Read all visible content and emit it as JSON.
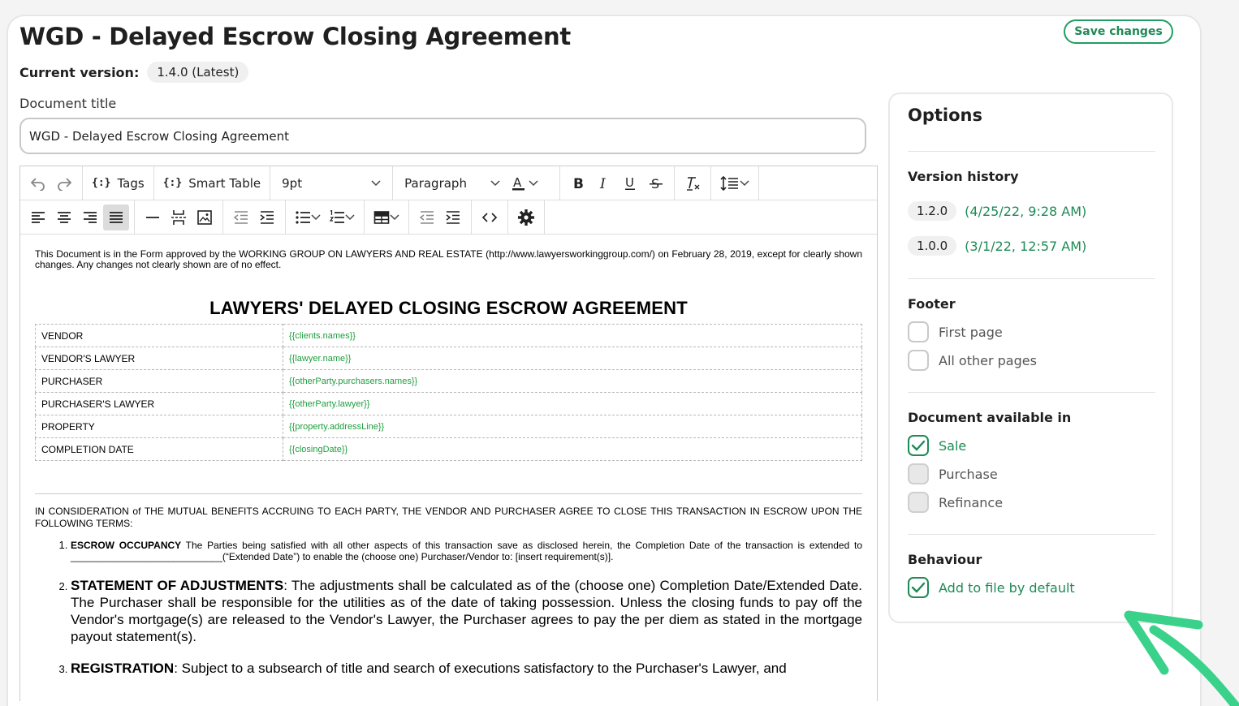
{
  "header": {
    "title": "WGD - Delayed Escrow Closing Agreement",
    "save_label": "Save changes",
    "version_label": "Current version:",
    "version_value": "1.4.0 (Latest)",
    "doc_title_label": "Document title",
    "doc_title_value": "WGD - Delayed Escrow Closing Agreement"
  },
  "toolbar": {
    "tags_label": "Tags",
    "smart_table_label": "Smart Table",
    "font_size": "9pt",
    "block_format": "Paragraph",
    "tag_glyph": "{:}"
  },
  "document": {
    "disclaimer": "This Document is in the Form approved by the WORKING GROUP ON LAWYERS AND REAL ESTATE (http://www.lawyersworkinggroup.com/) on February 28, 2019, except for clearly shown changes. Any changes not clearly shown are of no effect.",
    "heading": "LAWYERS' DELAYED CLOSING ESCROW AGREEMENT",
    "parties": [
      {
        "label": "VENDOR",
        "value": "{{clients.names}}"
      },
      {
        "label": "VENDOR'S LAWYER",
        "value": "{{lawyer.name}}"
      },
      {
        "label": "PURCHASER",
        "value": "{{otherParty.purchasers.names}}"
      },
      {
        "label": "PURCHASER'S LAWYER",
        "value": "{{otherParty.lawyer}}"
      },
      {
        "label": "PROPERTY",
        "value": "{{property.addressLine}}"
      },
      {
        "label": "COMPLETION DATE",
        "value": "{{closingDate}}"
      }
    ],
    "consideration": "IN CONSIDERATION of THE MUTUAL BENEFITS ACCRUING TO EACH PARTY, THE VENDOR AND PURCHASER AGREE TO CLOSE THIS TRANSACTION IN ESCROW UPON THE FOLLOWING TERMS:",
    "terms": [
      {
        "head": "ESCROW OCCUPANCY",
        "body": " The Parties being satisfied with all other aspects of this transaction save as disclosed herein, the Completion Date of the transaction is extended to ____________________________(“Extended Date”) to enable the (choose one) Purchaser/Vendor to: [insert requirement(s)]."
      },
      {
        "head": "STATEMENT OF ADJUSTMENTS",
        "body": ": The adjustments shall be calculated as of the (choose one) Completion Date/Extended Date. The Purchaser shall be responsible for the utilities as of the date of taking possession. Unless the closing funds to pay off the Vendor's mortgage(s) are released to the Vendor's Lawyer, the Purchaser agrees to pay the per diem as stated in the mortgage payout statement(s)."
      },
      {
        "head": "REGISTRATION",
        "body": ": Subject to a subsearch of title and search of executions satisfactory to the Purchaser's Lawyer, and"
      }
    ]
  },
  "options": {
    "heading": "Options",
    "version_history_title": "Version history",
    "versions": [
      {
        "version": "1.2.0",
        "date": "(4/25/22, 9:28 AM)"
      },
      {
        "version": "1.0.0",
        "date": "(3/1/22, 12:57 AM)"
      }
    ],
    "footer_title": "Footer",
    "footer_first": "First page",
    "footer_other": "All other pages",
    "available_title": "Document available in",
    "available_sale": "Sale",
    "available_purchase": "Purchase",
    "available_refinance": "Refinance",
    "behaviour_title": "Behaviour",
    "behaviour_add": "Add to file by default"
  },
  "colors": {
    "accent_green": "#1e8a55",
    "tag_green": "#1e9e3e",
    "arrow_green": "#3ad28a"
  }
}
